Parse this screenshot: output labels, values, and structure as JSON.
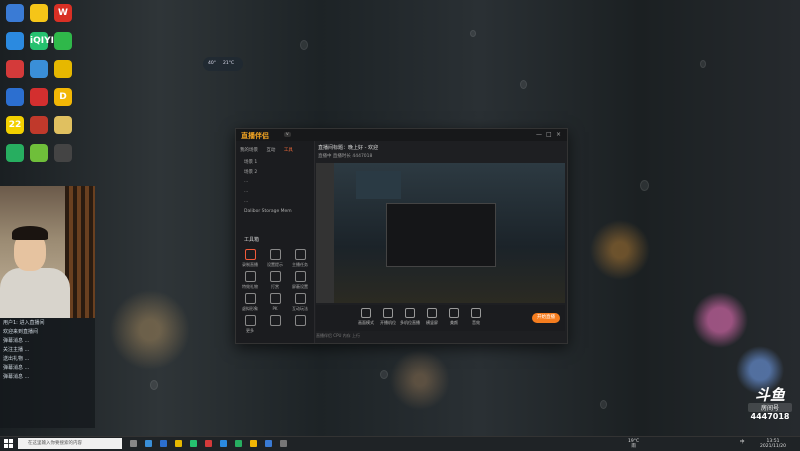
{
  "desktop": {
    "icons": [
      {
        "label": "",
        "color": "#3a7bd5"
      },
      {
        "label": "",
        "color": "#f5c518"
      },
      {
        "label": "W",
        "color": "#d93025"
      },
      {
        "label": "",
        "color": "#2b8ae0"
      },
      {
        "label": "iQIYI",
        "color": "#25c16f"
      },
      {
        "label": "",
        "color": "#2fb84a"
      },
      {
        "label": "",
        "color": "#d43a3a"
      },
      {
        "label": "",
        "color": "#3a8fd8"
      },
      {
        "label": "",
        "color": "#e6b800"
      },
      {
        "label": "",
        "color": "#2c6fd0"
      },
      {
        "label": "",
        "color": "#d32f2f"
      },
      {
        "label": "D",
        "color": "#f2b705"
      },
      {
        "label": "22",
        "color": "#f2d000"
      },
      {
        "label": "",
        "color": "#c0392b"
      },
      {
        "label": "",
        "color": "#e0c060"
      },
      {
        "label": "",
        "color": "#27ae60"
      },
      {
        "label": "",
        "color": "#6fbf3a"
      },
      {
        "label": "",
        "color": "#444"
      }
    ]
  },
  "weather": {
    "temp": "40°",
    "info": "21°C"
  },
  "window": {
    "app_title": "直播伴侣",
    "version": "v",
    "sidebar_tabs": [
      "我的场景",
      "互动",
      "工具"
    ],
    "sidebar_items": [
      "场景 1",
      "场景 2",
      "...",
      "...",
      "...",
      "Dalibor Storage Mem"
    ],
    "tools_title": "工具箱",
    "tools": [
      {
        "label": "录制直播",
        "red": true
      },
      {
        "label": "设置提示",
        "red": false
      },
      {
        "label": "主播任务",
        "red": false
      },
      {
        "label": "特效礼物",
        "red": false
      },
      {
        "label": "打赏",
        "red": false
      },
      {
        "label": "屏蔽设置",
        "red": false
      },
      {
        "label": "虚拟形象",
        "red": false
      },
      {
        "label": "PK",
        "red": false
      },
      {
        "label": "互动玩法",
        "red": false
      },
      {
        "label": "更多",
        "red": false
      },
      {
        "label": "",
        "red": false
      },
      {
        "label": "",
        "red": false
      }
    ],
    "stream_title": "直播间标题：晚上好 - 欢迎",
    "stream_sub": "直播中  直播时长  4447018",
    "bottom_buttons": [
      "画面模式",
      "开播机位",
      "多机位直播",
      "横竖屏",
      "美颜",
      "音效"
    ],
    "live_button": "开始直播",
    "footer": "直播伴侣  CPU  内存  上行",
    "window_controls": [
      "—",
      "□",
      "×"
    ]
  },
  "chat": {
    "lines": [
      "用户1: 进入直播间",
      "欢迎来到直播间",
      "弹幕消息 ...",
      "关注主播 ...",
      "送出礼物 ...",
      "弹幕消息 ...",
      "弹幕消息 ..."
    ]
  },
  "douyu": {
    "brand": "斗鱼",
    "room_label": "房间号",
    "room_number": "4447018"
  },
  "taskbar": {
    "search_placeholder": "在这里输入你要搜索的内容",
    "weather": "19°C",
    "weather_desc": "雨",
    "lang": "中",
    "time": "13:51",
    "date": "2021/11/20"
  }
}
